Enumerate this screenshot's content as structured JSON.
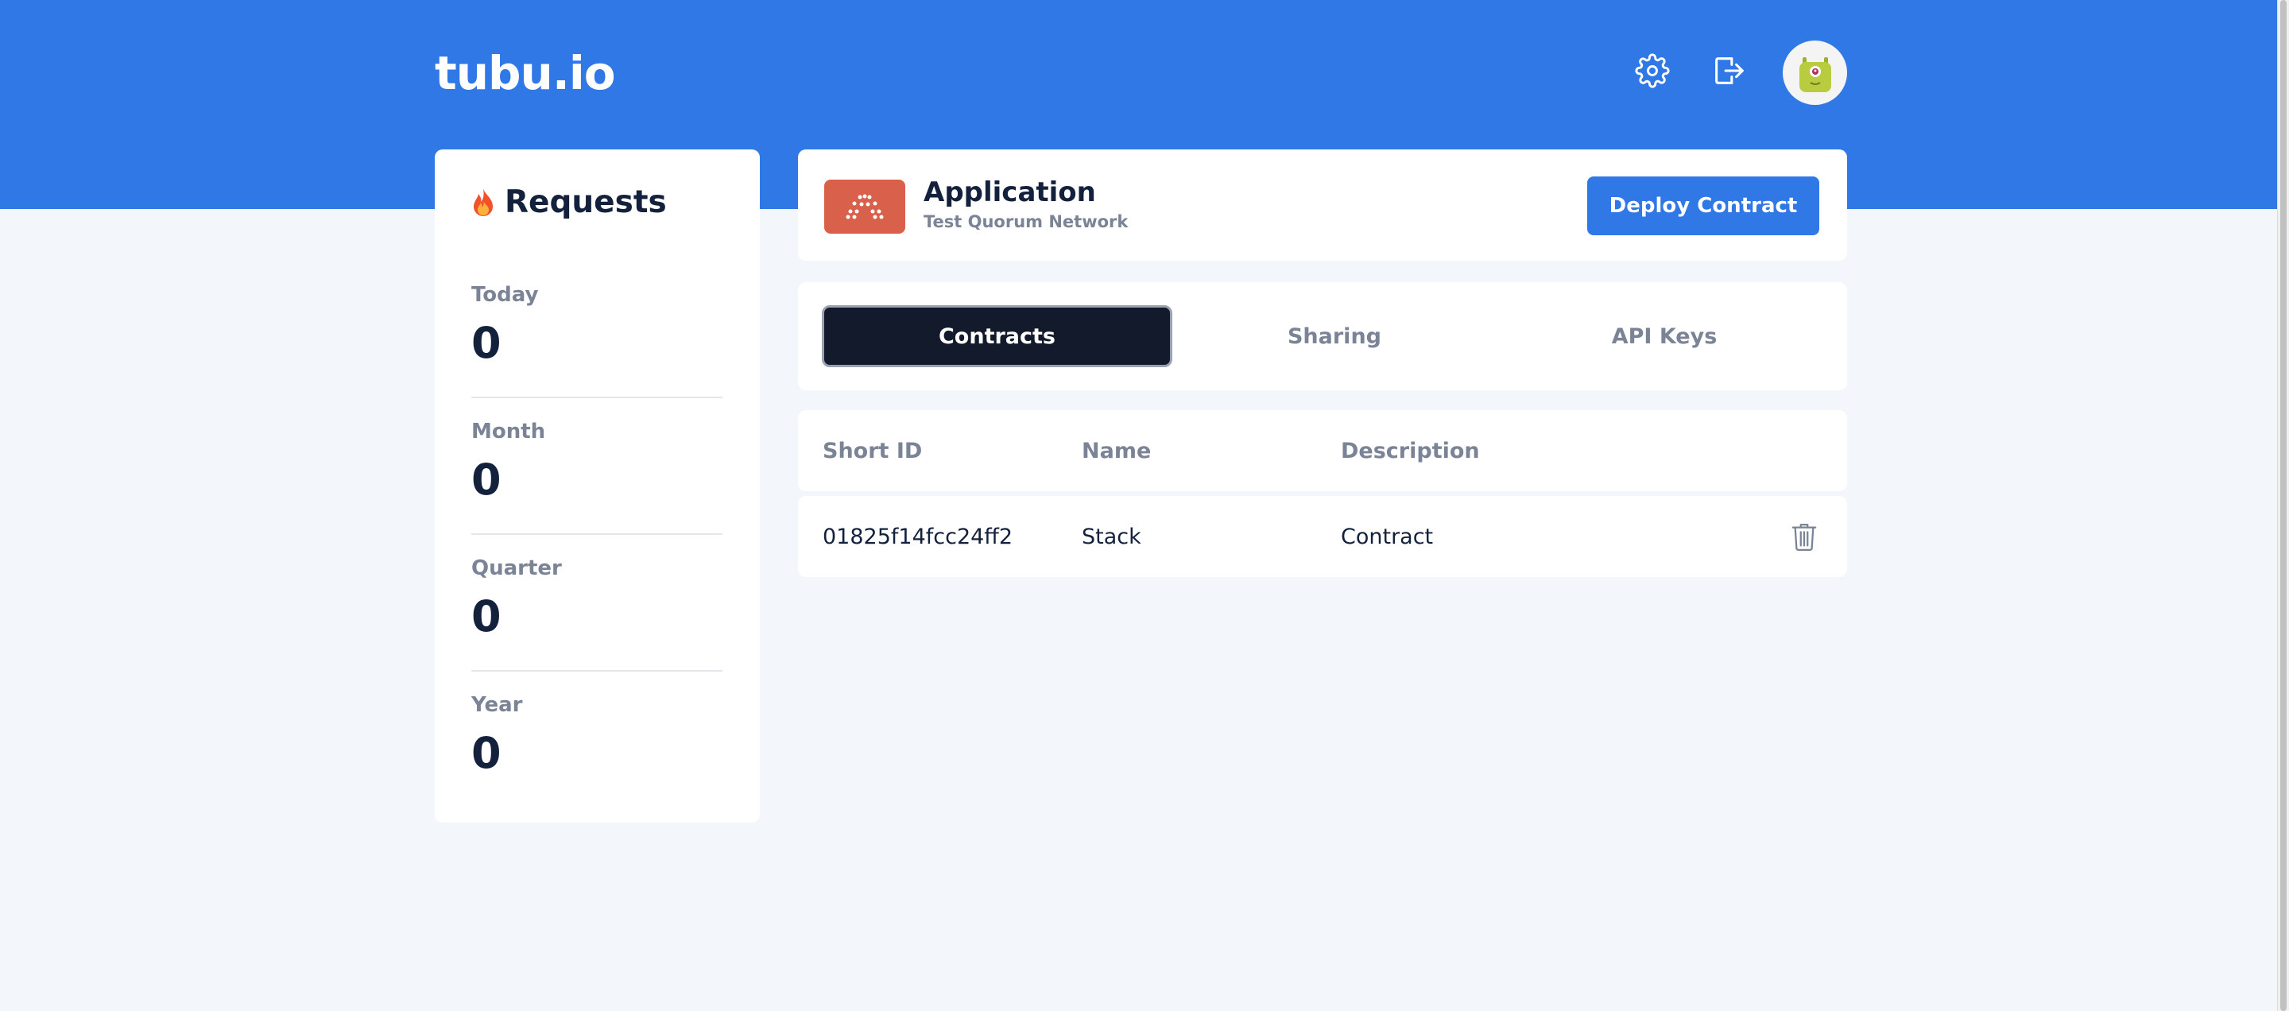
{
  "header": {
    "logo": "tubu.io",
    "icons": {
      "settings": "gear-icon",
      "logout": "logout-icon",
      "avatar": "robot-avatar"
    }
  },
  "colors": {
    "brand_blue": "#3078e6",
    "page_bg": "#f3f6fb",
    "dark_navy": "#121a2b",
    "muted_text": "#7b8496",
    "app_thumb": "#d9604a"
  },
  "requests": {
    "icon": "fire-icon",
    "title": "Requests",
    "stats": [
      {
        "label": "Today",
        "value": "0"
      },
      {
        "label": "Month",
        "value": "0"
      },
      {
        "label": "Quarter",
        "value": "0"
      },
      {
        "label": "Year",
        "value": "0"
      }
    ]
  },
  "application": {
    "name": "Application",
    "network": "Test Quorum Network",
    "deploy_label": "Deploy Contract"
  },
  "tabs": [
    {
      "label": "Contracts",
      "active": true
    },
    {
      "label": "Sharing",
      "active": false
    },
    {
      "label": "API Keys",
      "active": false
    }
  ],
  "contracts_table": {
    "columns": [
      "Short ID",
      "Name",
      "Description"
    ],
    "rows": [
      {
        "short_id": "01825f14fcc24ff2",
        "name": "Stack",
        "description": "Contract",
        "action_icon": "trash-icon"
      }
    ]
  }
}
